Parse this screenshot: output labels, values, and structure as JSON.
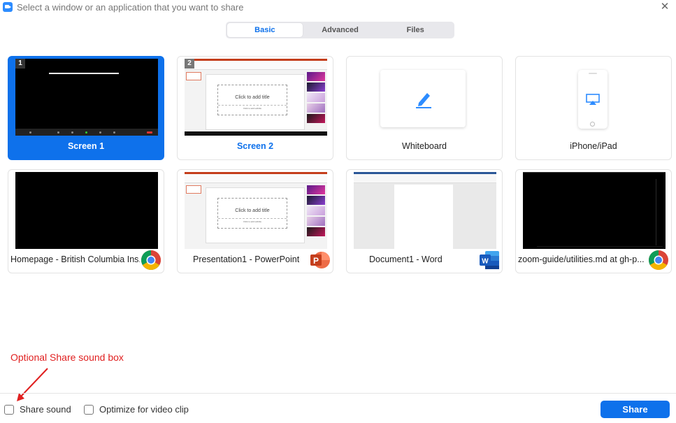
{
  "window": {
    "title": "Select a window or an application that you want to share",
    "close_glyph": "✕"
  },
  "tabs": [
    {
      "label": "Basic",
      "active": true
    },
    {
      "label": "Advanced",
      "active": false
    },
    {
      "label": "Files",
      "active": false
    }
  ],
  "sources": [
    {
      "label": "Screen 1",
      "kind": "screen",
      "number": "1",
      "selected": true
    },
    {
      "label": "Screen 2",
      "kind": "screen",
      "number": "2",
      "selected": false
    },
    {
      "label": "Whiteboard",
      "kind": "whiteboard",
      "icon": "pen-icon"
    },
    {
      "label": "iPhone/iPad",
      "kind": "device",
      "icon": "airplay-icon"
    },
    {
      "label": "Homepage - British Columbia Ins...",
      "kind": "window",
      "app_icon": "chrome-icon"
    },
    {
      "label": "Presentation1 - PowerPoint",
      "kind": "window",
      "app_icon": "powerpoint-icon",
      "thumb_title": "Click to add title",
      "thumb_subtitle": "Click to add subtitle"
    },
    {
      "label": "Document1 - Word",
      "kind": "window",
      "app_icon": "word-icon"
    },
    {
      "label": "zoom-guide/utilities.md at gh-p...",
      "kind": "window",
      "app_icon": "chrome-icon"
    }
  ],
  "screen2_thumb": {
    "title": "Click to add title",
    "subtitle": "Click to add subtitle"
  },
  "options": {
    "share_sound": {
      "label": "Share sound",
      "checked": false
    },
    "optimize_video": {
      "label": "Optimize for video clip",
      "checked": false
    }
  },
  "share_button": {
    "label": "Share"
  },
  "annotation": {
    "text": "Optional Share sound box"
  },
  "colors": {
    "accent": "#0e71eb",
    "annotation": "#e02020"
  }
}
